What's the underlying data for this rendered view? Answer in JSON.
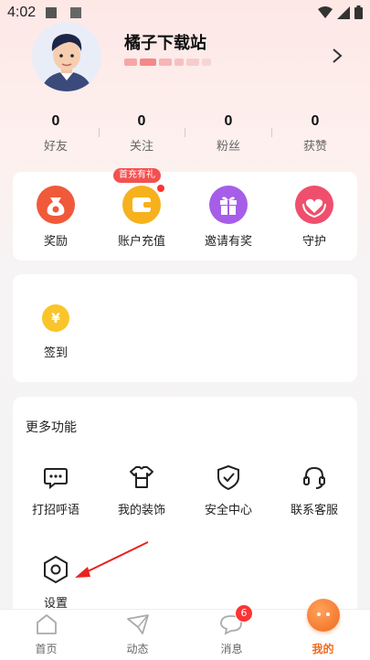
{
  "statusbar": {
    "time": "4:02"
  },
  "profile": {
    "username": "橘子下载站"
  },
  "stats": [
    {
      "num": "0",
      "label": "好友"
    },
    {
      "num": "0",
      "label": "关注"
    },
    {
      "num": "0",
      "label": "粉丝"
    },
    {
      "num": "0",
      "label": "获赞"
    }
  ],
  "quick": {
    "badge": "首充有礼",
    "items": [
      {
        "label": "奖励",
        "icon": "money-bag-icon",
        "color": "#f05a3a"
      },
      {
        "label": "账户充值",
        "icon": "wallet-icon",
        "color": "#f6b11c"
      },
      {
        "label": "邀请有奖",
        "icon": "gift-icon",
        "color": "#a65ee8"
      },
      {
        "label": "守护",
        "icon": "heart-hands-icon",
        "color": "#ef4f6d"
      }
    ]
  },
  "checkin": {
    "label": "签到",
    "icon": "yuan-coin-icon"
  },
  "more": {
    "title": "更多功能",
    "items": [
      {
        "label": "打招呼语",
        "icon": "chat-bubble-icon"
      },
      {
        "label": "我的装饰",
        "icon": "shirt-icon"
      },
      {
        "label": "安全中心",
        "icon": "shield-check-icon"
      },
      {
        "label": "联系客服",
        "icon": "headset-icon"
      },
      {
        "label": "设置",
        "icon": "hexagon-settings-icon"
      }
    ]
  },
  "tabs": [
    {
      "label": "首页",
      "icon": "home-icon"
    },
    {
      "label": "动态",
      "icon": "paper-plane-icon"
    },
    {
      "label": "消息",
      "icon": "message-icon",
      "badge": "6"
    },
    {
      "label": "",
      "icon": "app-center-icon"
    },
    {
      "label": "我的",
      "icon": "me-icon",
      "active": true
    }
  ],
  "accent": "#f06a20"
}
